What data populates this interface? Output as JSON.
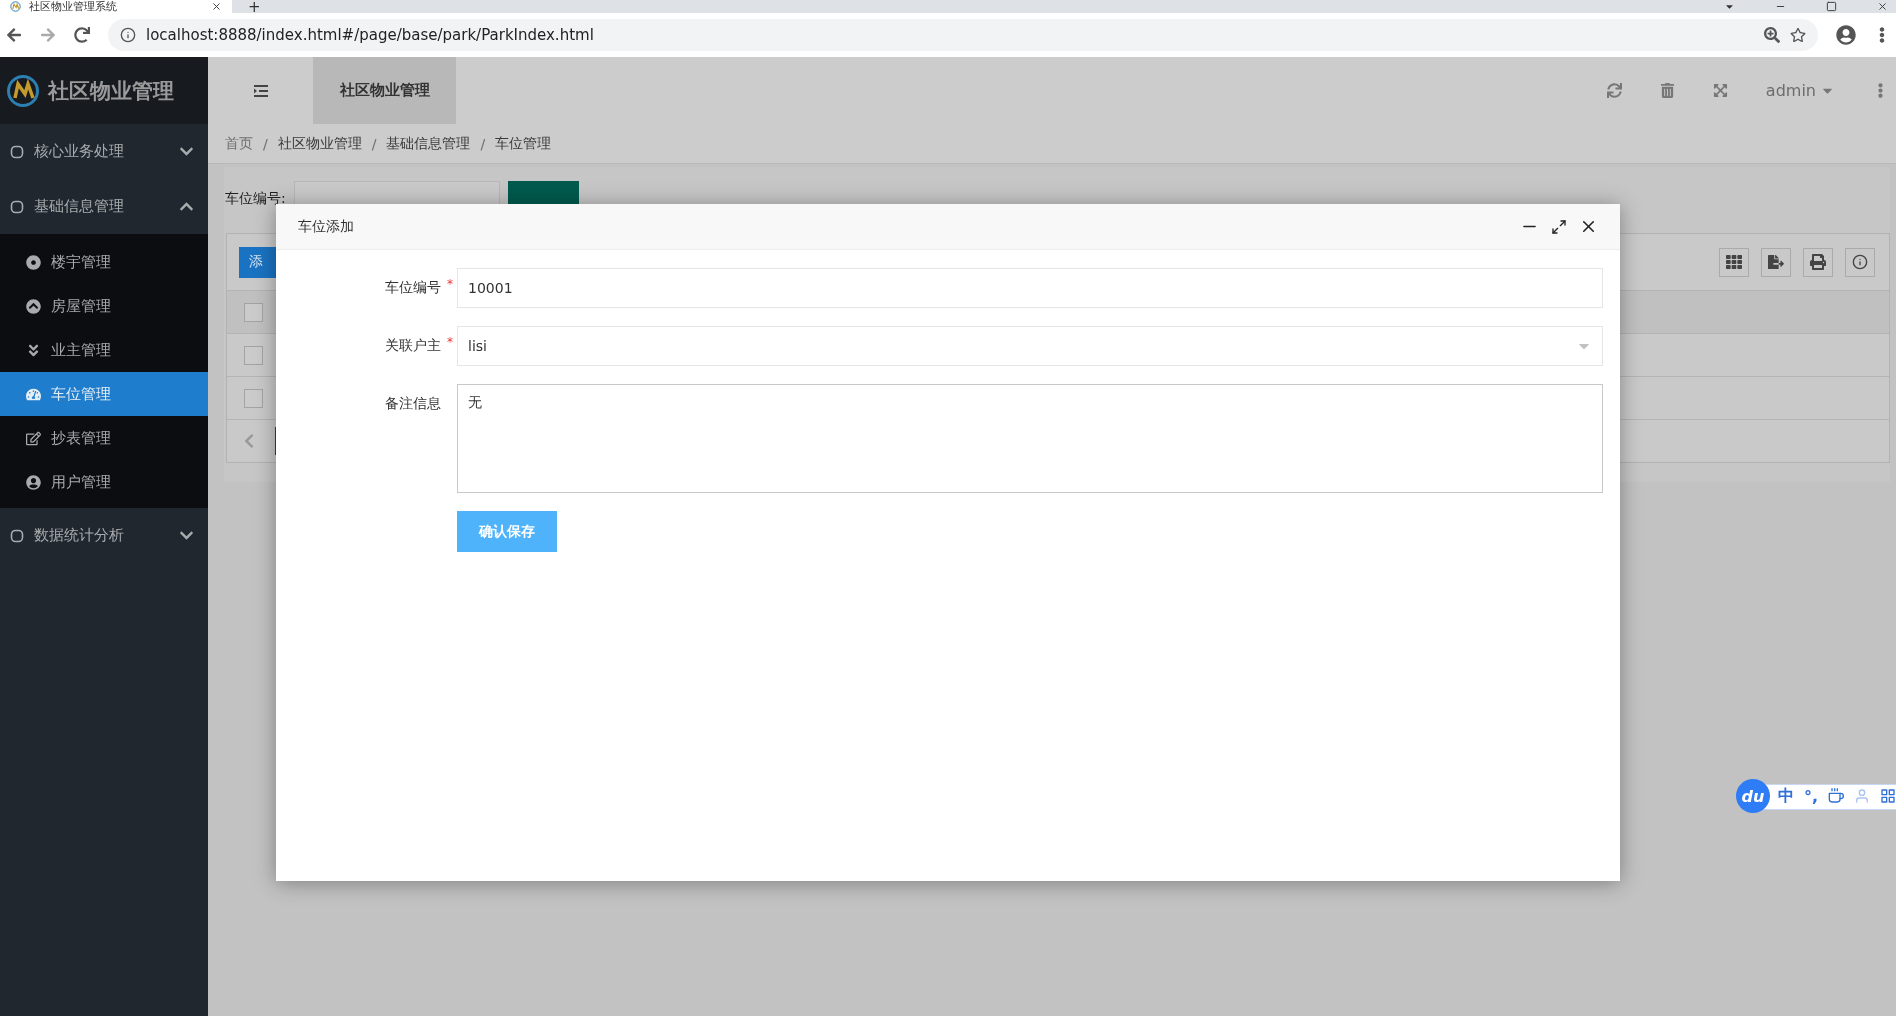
{
  "browser": {
    "tab_title": "社区物业管理系统",
    "new_tab": "+",
    "url": "localhost:8888/index.html#/page/base/park/ParkIndex.html"
  },
  "header": {
    "logo_text": "社区物业管理",
    "tab": "社区物业管理",
    "user": "admin"
  },
  "sidebar": {
    "items": [
      {
        "label": "核心业务处理",
        "expanded": false
      },
      {
        "label": "基础信息管理",
        "expanded": true,
        "children": [
          {
            "label": "楼宇管理",
            "selected": false
          },
          {
            "label": "房屋管理",
            "selected": false
          },
          {
            "label": "业主管理",
            "selected": false
          },
          {
            "label": "车位管理",
            "selected": true
          },
          {
            "label": "抄表管理",
            "selected": false
          },
          {
            "label": "用户管理",
            "selected": false
          }
        ]
      },
      {
        "label": "数据统计分析",
        "expanded": false
      }
    ]
  },
  "breadcrumb": {
    "separator": "/",
    "items": [
      "首页",
      "社区物业管理",
      "基础信息管理",
      "车位管理"
    ]
  },
  "search": {
    "label": "车位编号:"
  },
  "table": {
    "add_button": "添",
    "header_checked": false,
    "rows": [
      {
        "checked": false
      },
      {
        "checked": false
      }
    ]
  },
  "dialog": {
    "title": "车位添加",
    "required_mark": "*",
    "fields": [
      {
        "kind": "input",
        "label": "车位编号",
        "required": true,
        "value": "10001"
      },
      {
        "kind": "select",
        "label": "关联户主",
        "required": true,
        "value": "lisi"
      },
      {
        "kind": "textarea",
        "label": "备注信息",
        "required": false,
        "value": "无"
      }
    ],
    "submit": "确认保存"
  },
  "ime": {
    "logo": "du",
    "items": [
      "中",
      "°,"
    ]
  }
}
